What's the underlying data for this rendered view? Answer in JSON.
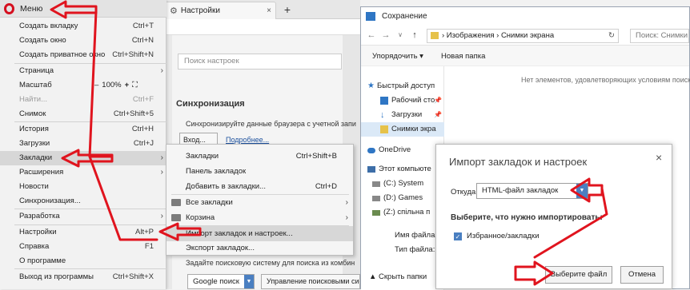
{
  "browser": {
    "tab_title": "Настройки",
    "new_tab": "+",
    "tab_close": "×",
    "settings": {
      "search_placeholder": "Поиск настроек",
      "sync_title": "Синхронизация",
      "sync_desc": "Синхронизируйте данные браузера с учетной запи",
      "login_btn": "Вход...",
      "more_link": "Подробнее...",
      "search_engine_desc": "Задайте поисковую систему для поиска из комбин",
      "engine": "Google поиск",
      "manage_engines": "Управление поисковыми системами..."
    }
  },
  "menu": {
    "title": "Меню",
    "items": [
      {
        "label": "Создать вкладку",
        "shortcut": "Ctrl+T"
      },
      {
        "label": "Создать окно",
        "shortcut": "Ctrl+N"
      },
      {
        "label": "Создать приватное окно",
        "shortcut": "Ctrl+Shift+N"
      },
      {
        "label": "Страница",
        "shortcut": ""
      },
      {
        "label": "Масштаб",
        "shortcut": ""
      },
      {
        "label": "Найти...",
        "shortcut": "Ctrl+F"
      },
      {
        "label": "Снимок",
        "shortcut": "Ctrl+Shift+5"
      },
      {
        "label": "История",
        "shortcut": "Ctrl+H"
      },
      {
        "label": "Загрузки",
        "shortcut": "Ctrl+J"
      },
      {
        "label": "Закладки",
        "shortcut": ""
      },
      {
        "label": "Расширения",
        "shortcut": ""
      },
      {
        "label": "Новости",
        "shortcut": ""
      },
      {
        "label": "Синхронизация...",
        "shortcut": ""
      },
      {
        "label": "Разработка",
        "shortcut": ""
      },
      {
        "label": "Настройки",
        "shortcut": "Alt+P"
      },
      {
        "label": "Справка",
        "shortcut": "F1"
      },
      {
        "label": "О программе",
        "shortcut": ""
      },
      {
        "label": "Выход из программы",
        "shortcut": "Ctrl+Shift+X"
      }
    ],
    "zoom": {
      "minus": "–",
      "value": "100%",
      "plus": "+",
      "fullscreen": "⛶"
    }
  },
  "bookmarks_submenu": {
    "items": [
      {
        "label": "Закладки",
        "shortcut": "Ctrl+Shift+B"
      },
      {
        "label": "Панель закладок",
        "shortcut": ""
      },
      {
        "label": "Добавить в закладки...",
        "shortcut": "Ctrl+D"
      },
      {
        "label": "Все закладки",
        "shortcut": ""
      },
      {
        "label": "Корзина",
        "shortcut": ""
      },
      {
        "label": "Импорт закладок и настроек...",
        "shortcut": ""
      },
      {
        "label": "Экспорт закладок...",
        "shortcut": ""
      }
    ]
  },
  "save_dialog": {
    "title": "Сохранение",
    "path": "› Изображения › Снимки экрана",
    "search_placeholder": "Поиск: Снимки",
    "organize": "Упорядочить ▾",
    "new_folder": "Новая папка",
    "nav": [
      {
        "label": "Быстрый доступ"
      },
      {
        "label": "Рабочий сто"
      },
      {
        "label": "Загрузки"
      },
      {
        "label": "Снимки экра"
      },
      {
        "label": "OneDrive"
      },
      {
        "label": "Этот компьюте"
      },
      {
        "label": "(C:) System"
      },
      {
        "label": "(D:) Games"
      },
      {
        "label": "(Z:) спільна п"
      }
    ],
    "empty_message": "Нет элементов, удовлетворяющих условиям поиск",
    "filename_label": "Имя файла:",
    "filetype_label": "Тип файла:",
    "hide_folders": "▲ Скрыть папки"
  },
  "import_dialog": {
    "title": "Импорт закладок и настроек",
    "close": "×",
    "from_label": "Откуда:",
    "from_value": "HTML-файл закладок",
    "choose_label": "Выберите, что нужно импортировать:",
    "checkbox_label": "Избранное/закладки",
    "choose_file_btn": "Выберите файл",
    "cancel_btn": "Отмена"
  },
  "colors": {
    "opera_red": "#d50f1f",
    "annotation_red": "#e0141e",
    "accent_blue": "#4a7fc1"
  }
}
